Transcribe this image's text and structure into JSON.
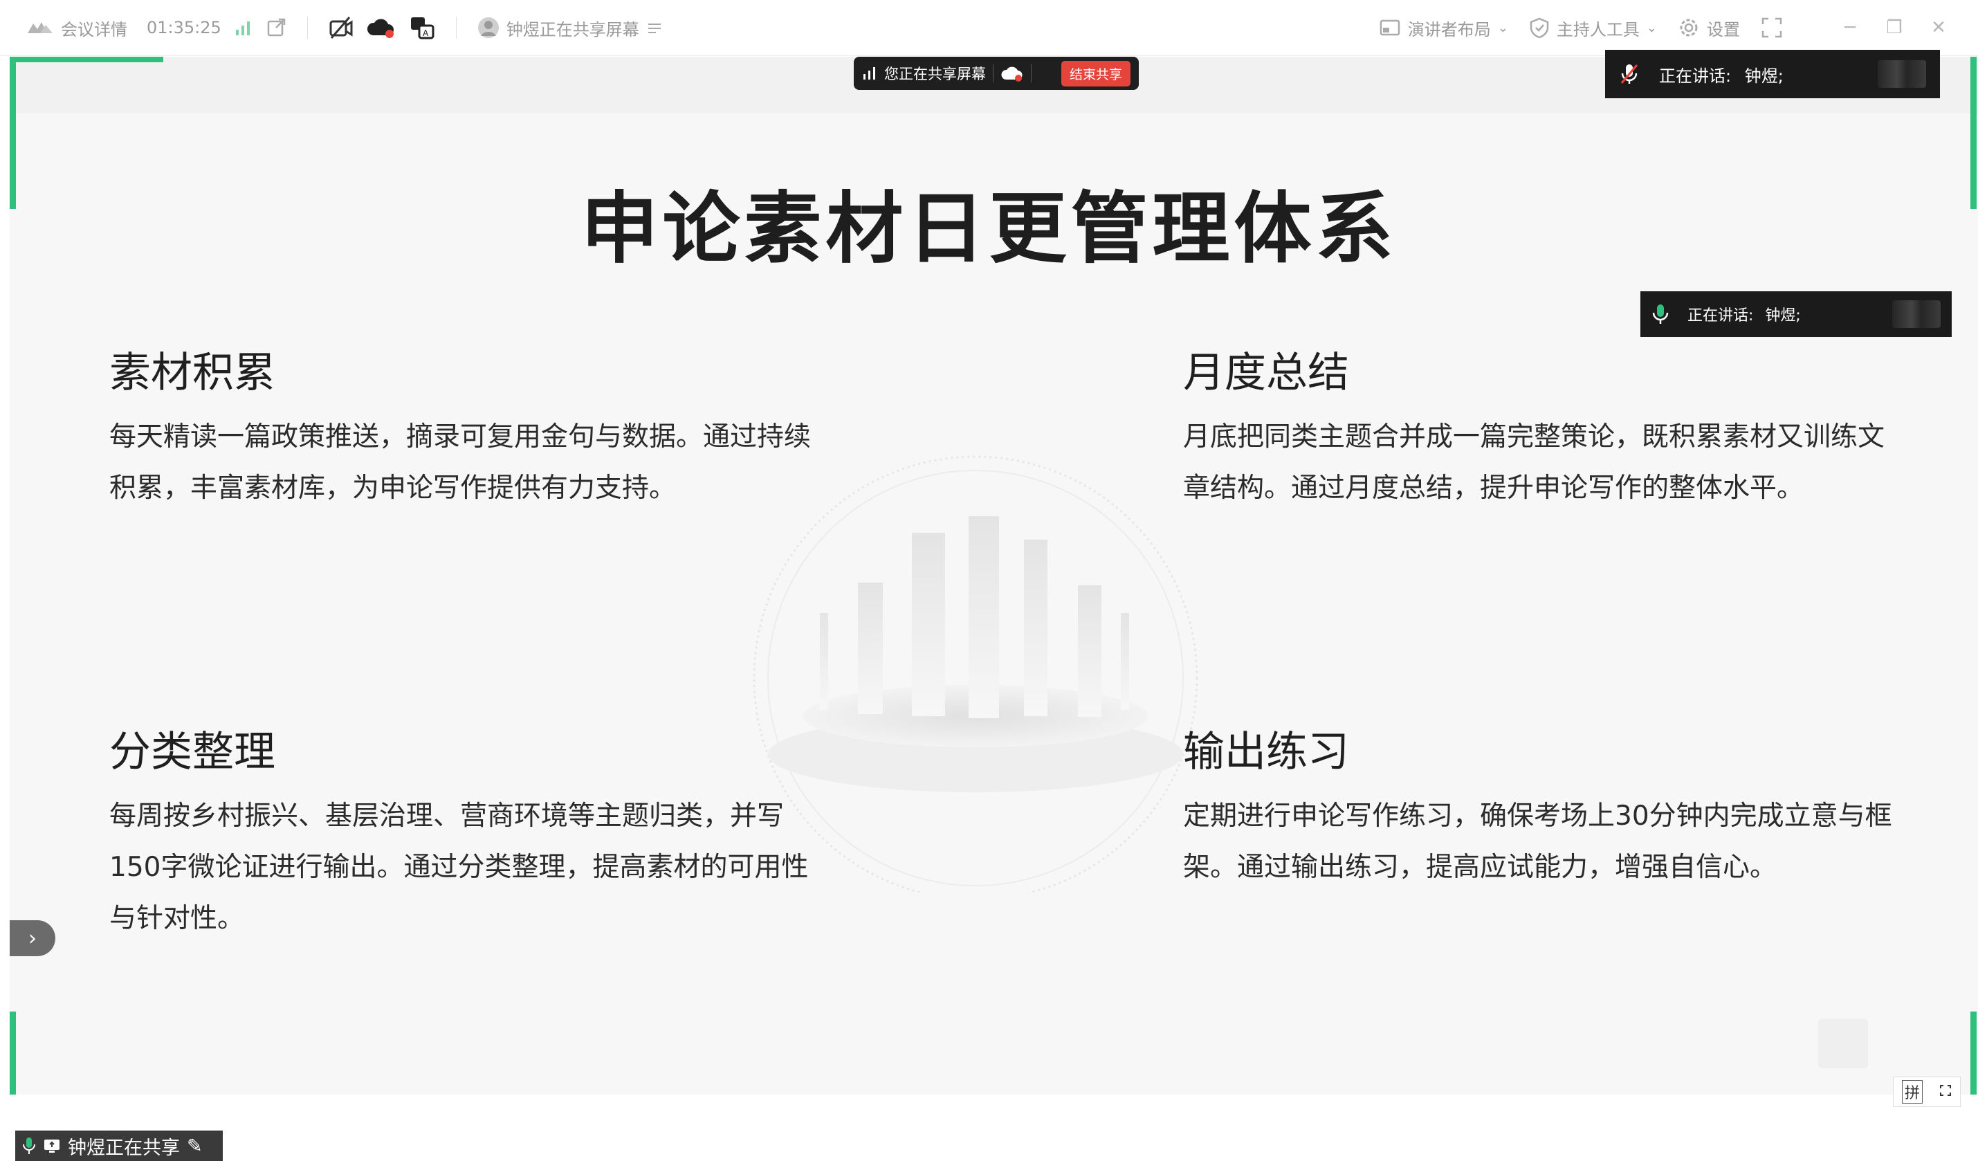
{
  "topbar": {
    "meeting_details": "会议详情",
    "timer": "01:35:25",
    "share_status": "钟煜正在共享屏幕",
    "presenter_layout": "演讲者布局",
    "host_tools": "主持人工具",
    "settings": "设置"
  },
  "share_pill": {
    "label": "您正在共享屏幕",
    "stop_button": "结束共享"
  },
  "speaking_banner": {
    "label": "正在讲话:",
    "name": "钟煜;"
  },
  "slide": {
    "title": "申论素材日更管理体系",
    "sections": [
      {
        "heading": "素材积累",
        "body": "每天精读一篇政策推送，摘录可复用金句与数据。通过持续积累，丰富素材库，为申论写作提供有力支持。"
      },
      {
        "heading": "月度总结",
        "body": "月底把同类主题合并成一篇完整策论，既积累素材又训练文章结构。通过月度总结，提升申论写作的整体水平。"
      },
      {
        "heading": "分类整理",
        "body": "每周按乡村振兴、基层治理、营商环境等主题归类，并写150字微论证进行输出。通过分类整理，提高素材的可用性与针对性。"
      },
      {
        "heading": "输出练习",
        "body": "定期进行申论写作练习，确保考场上30分钟内完成立意与框架。通过输出练习，提高应试能力，增强自信心。"
      }
    ]
  },
  "bottom": {
    "sharing_label": "钟煜正在共享",
    "ime_label": "拼"
  },
  "colors": {
    "accent_green": "#2fc07d",
    "stop_red": "#e5443a"
  }
}
